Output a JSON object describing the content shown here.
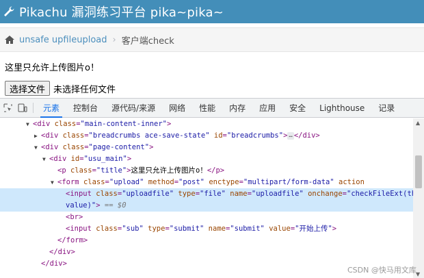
{
  "appbar": {
    "title": "Pikachu 漏洞练习平台 pika~pika~",
    "icon": "wrench-icon"
  },
  "breadcrumb": {
    "link": "unsafe upfileupload",
    "current": "客户端check"
  },
  "page": {
    "title": "这里只允许上传图片o！",
    "file_button": "选择文件",
    "file_status": "未选择任何文件"
  },
  "devtools": {
    "tabs": [
      "元素",
      "控制台",
      "源代码/来源",
      "网络",
      "性能",
      "内存",
      "应用",
      "安全",
      "Lighthouse",
      "记录"
    ],
    "active_tab": "元素",
    "dom": {
      "l1": {
        "open": "<div ",
        "an1": "class",
        "av1": "\"main-content-inner\"",
        "close": ">"
      },
      "l2": {
        "open": "<div ",
        "an1": "class",
        "av1": "\"breadcrumbs ace-save-state\"",
        "an2": "id",
        "av2": "\"breadcrumbs\"",
        "close": ">",
        "ellipsis": "…",
        "end": "</div>"
      },
      "l3": {
        "open": "<div ",
        "an1": "class",
        "av1": "\"page-content\"",
        "close": ">"
      },
      "l4": {
        "open": "<div ",
        "an1": "id",
        "av1": "\"usu_main\"",
        "close": ">"
      },
      "l5": {
        "open": "<p ",
        "an1": "class",
        "av1": "\"title\"",
        "close": ">",
        "text": "这里只允许上传图片o！",
        "end": "</p>"
      },
      "l6": {
        "open": "<form ",
        "an1": "class",
        "av1": "\"upload\"",
        "an2": "method",
        "av2": "\"post\"",
        "an3": "enctype",
        "av3": "\"multipart/form-data\"",
        "an4": "action"
      },
      "l7": {
        "open": "<input ",
        "an1": "class",
        "av1": "\"uploadfile\"",
        "an2": "type",
        "av2": "\"file\"",
        "an3": "name",
        "av3": "\"uploadfile\"",
        "an4": "onchange",
        "av4": "\"checkFileExt(this."
      },
      "l8": {
        "av": "value)\"",
        "close": ">",
        "eq": "== $0"
      },
      "l9": {
        "tag": "<br>"
      },
      "l10": {
        "open": "<input ",
        "an1": "class",
        "av1": "\"sub\"",
        "an2": "type",
        "av2": "\"submit\"",
        "an3": "name",
        "av3": "\"submit\"",
        "an4": "value",
        "av4": "\"开始上传\"",
        "close": ">"
      },
      "l11": {
        "tag": "</form>"
      },
      "l12": {
        "tag": "</div>"
      },
      "l13": {
        "tag": "</div>"
      }
    }
  },
  "watermark": "CSDN @快马用文库"
}
